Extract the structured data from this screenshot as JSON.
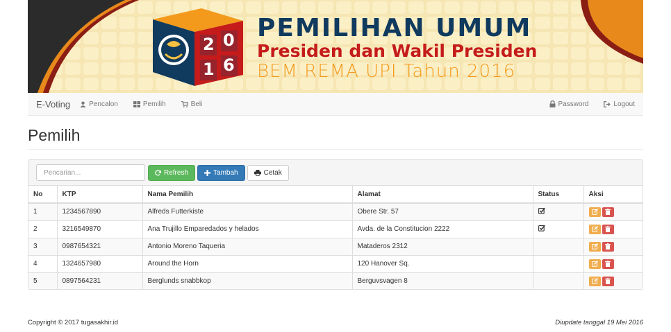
{
  "banner": {
    "title_line1": "PEMILIHAN UMUM",
    "title_line2": "Presiden dan Wakil Presiden",
    "title_line3": "BEM REMA UPI Tahun 2016",
    "year_digits": [
      "2",
      "0",
      "1",
      "6"
    ],
    "colors": {
      "navy": "#103a5e",
      "red": "#c51b1b",
      "orange": "#f39a1c",
      "background": "#f6e6b3"
    }
  },
  "navbar": {
    "brand": "E-Voting",
    "items": [
      {
        "label": "Pencalon",
        "icon": "user-icon"
      },
      {
        "label": "Pemilih",
        "icon": "grid-icon"
      },
      {
        "label": "Beli",
        "icon": "cart-icon"
      }
    ],
    "right_items": [
      {
        "label": "Password",
        "icon": "lock-icon"
      },
      {
        "label": "Logout",
        "icon": "logout-icon"
      }
    ]
  },
  "page": {
    "title": "Pemilih"
  },
  "toolbar": {
    "search_placeholder": "Pencarian...",
    "refresh_label": "Refresh",
    "add_label": "Tambah",
    "print_label": "Cetak"
  },
  "table": {
    "headers": {
      "no": "No",
      "ktp": "KTP",
      "nama": "Nama Pemilih",
      "alamat": "Alamat",
      "status": "Status",
      "aksi": "Aksi"
    },
    "rows": [
      {
        "no": "1",
        "ktp": "1234567890",
        "nama": "Alfreds Futterkiste",
        "alamat": "Obere Str. 57",
        "status": true
      },
      {
        "no": "2",
        "ktp": "3216549870",
        "nama": "Ana Trujillo Emparedados y helados",
        "alamat": "Avda. de la Constitucion 2222",
        "status": true
      },
      {
        "no": "3",
        "ktp": "0987654321",
        "nama": "Antonio Moreno Taqueria",
        "alamat": "Mataderos 2312",
        "status": false
      },
      {
        "no": "4",
        "ktp": "1324657980",
        "nama": "Around the Horn",
        "alamat": "120 Hanover Sq.",
        "status": false
      },
      {
        "no": "5",
        "ktp": "0897564231",
        "nama": "Berglunds snabbkop",
        "alamat": "Berguvsvagen 8",
        "status": false
      }
    ]
  },
  "footer": {
    "copyright": "Copyright © 2017 tugasakhir.id",
    "updated": "Diupdate tanggal 19 Mei 2016"
  }
}
